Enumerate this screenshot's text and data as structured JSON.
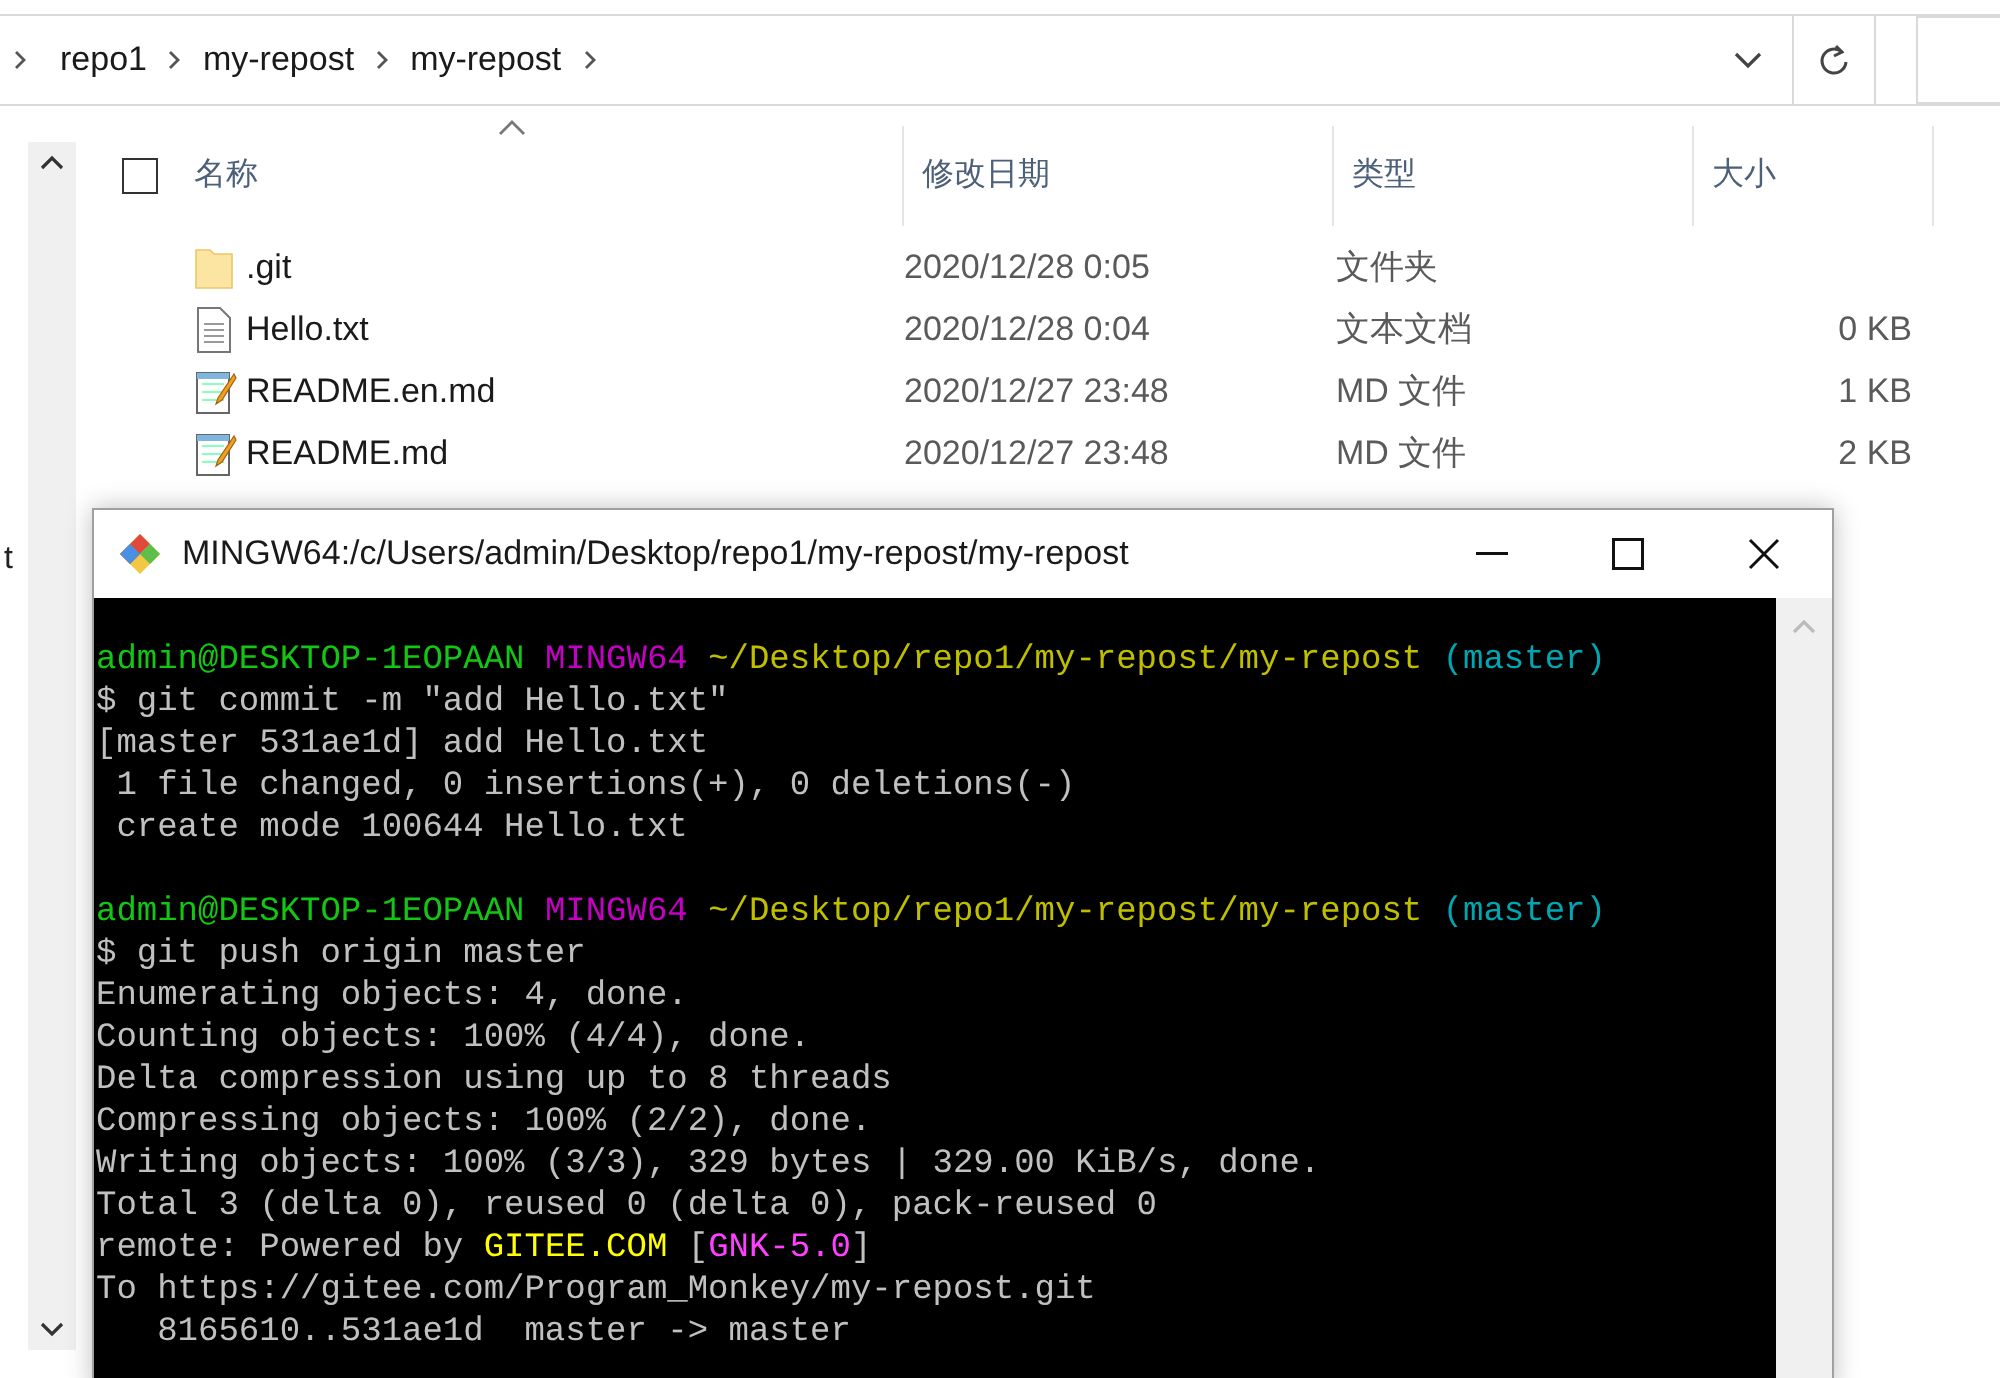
{
  "explorer": {
    "breadcrumbs": [
      "repo1",
      "my-repost",
      "my-repost"
    ],
    "nav_fragment": "t",
    "select_all": {
      "checked": false
    },
    "columns": [
      "名称",
      "修改日期",
      "类型",
      "大小"
    ],
    "files": [
      {
        "kind": "folder",
        "name": ".git",
        "modified": "2020/12/28 0:05",
        "type": "文件夹"
      },
      {
        "kind": "text",
        "name": "Hello.txt",
        "modified": "2020/12/28 0:04",
        "type": "文本文档",
        "size": "0 KB"
      },
      {
        "kind": "markdown",
        "name": "README.en.md",
        "modified": "2020/12/27 23:48",
        "type": "MD 文件",
        "size": "1 KB"
      },
      {
        "kind": "markdown",
        "name": "README.md",
        "modified": "2020/12/27 23:48",
        "type": "MD 文件",
        "size": "2 KB"
      }
    ]
  },
  "terminal": {
    "title": "MINGW64:/c/Users/admin/Desktop/repo1/my-repost/my-repost",
    "lines": [
      {
        "kind": "text",
        "segments": [
          {
            "text": "admin@DESKTOP-1EOPAAN ",
            "color": "#13c613"
          },
          {
            "text": "MINGW64 ",
            "color": "#c300c3"
          },
          {
            "text": "~/Desktop/repo1/my-repost/my-repost ",
            "color": "#bfbf00"
          },
          {
            "text": "(master)",
            "color": "#00a6b2"
          }
        ]
      },
      {
        "kind": "text",
        "segments": [
          {
            "text": "$ git commit -m \"add Hello.txt\"",
            "color": "#c0c0c0"
          }
        ]
      },
      {
        "kind": "text",
        "segments": [
          {
            "text": "[master 531ae1d] add Hello.txt",
            "color": "#c0c0c0"
          }
        ]
      },
      {
        "kind": "text",
        "segments": [
          {
            "text": " 1 file changed, 0 insertions(+), 0 deletions(-)",
            "color": "#c0c0c0"
          }
        ]
      },
      {
        "kind": "text",
        "segments": [
          {
            "text": " create mode 100644 Hello.txt",
            "color": "#c0c0c0"
          }
        ]
      },
      {
        "kind": "blank"
      },
      {
        "kind": "text",
        "segments": [
          {
            "text": "admin@DESKTOP-1EOPAAN ",
            "color": "#13c613"
          },
          {
            "text": "MINGW64 ",
            "color": "#c300c3"
          },
          {
            "text": "~/Desktop/repo1/my-repost/my-repost ",
            "color": "#bfbf00"
          },
          {
            "text": "(master)",
            "color": "#00a6b2"
          }
        ]
      },
      {
        "kind": "text",
        "segments": [
          {
            "text": "$ git push origin master",
            "color": "#c0c0c0"
          }
        ]
      },
      {
        "kind": "text",
        "segments": [
          {
            "text": "Enumerating objects: 4, done.",
            "color": "#c0c0c0"
          }
        ]
      },
      {
        "kind": "text",
        "segments": [
          {
            "text": "Counting objects: 100% (4/4), done.",
            "color": "#c0c0c0"
          }
        ]
      },
      {
        "kind": "text",
        "segments": [
          {
            "text": "Delta compression using up to 8 threads",
            "color": "#c0c0c0"
          }
        ]
      },
      {
        "kind": "text",
        "segments": [
          {
            "text": "Compressing objects: 100% (2/2), done.",
            "color": "#c0c0c0"
          }
        ]
      },
      {
        "kind": "text",
        "segments": [
          {
            "text": "Writing objects: 100% (3/3), 329 bytes | 329.00 KiB/s, done.",
            "color": "#c0c0c0"
          }
        ]
      },
      {
        "kind": "text",
        "segments": [
          {
            "text": "Total 3 (delta 0), reused 0 (delta 0), pack-reused 0",
            "color": "#c0c0c0"
          }
        ]
      },
      {
        "kind": "text",
        "segments": [
          {
            "text": "remote: Powered by ",
            "color": "#c0c0c0"
          },
          {
            "text": "GITEE.COM ",
            "color": "#ffff00"
          },
          {
            "text": "[",
            "color": "#c0c0c0"
          },
          {
            "text": "GNK-5.0",
            "color": "#ff40ff"
          },
          {
            "text": "]",
            "color": "#c0c0c0"
          }
        ]
      },
      {
        "kind": "text",
        "segments": [
          {
            "text": "To https://gitee.com/Program_Monkey/my-repost.git",
            "color": "#c0c0c0"
          }
        ]
      },
      {
        "kind": "text",
        "segments": [
          {
            "text": "   8165610..531ae1d  master -> master",
            "color": "#c0c0c0"
          }
        ]
      }
    ]
  }
}
